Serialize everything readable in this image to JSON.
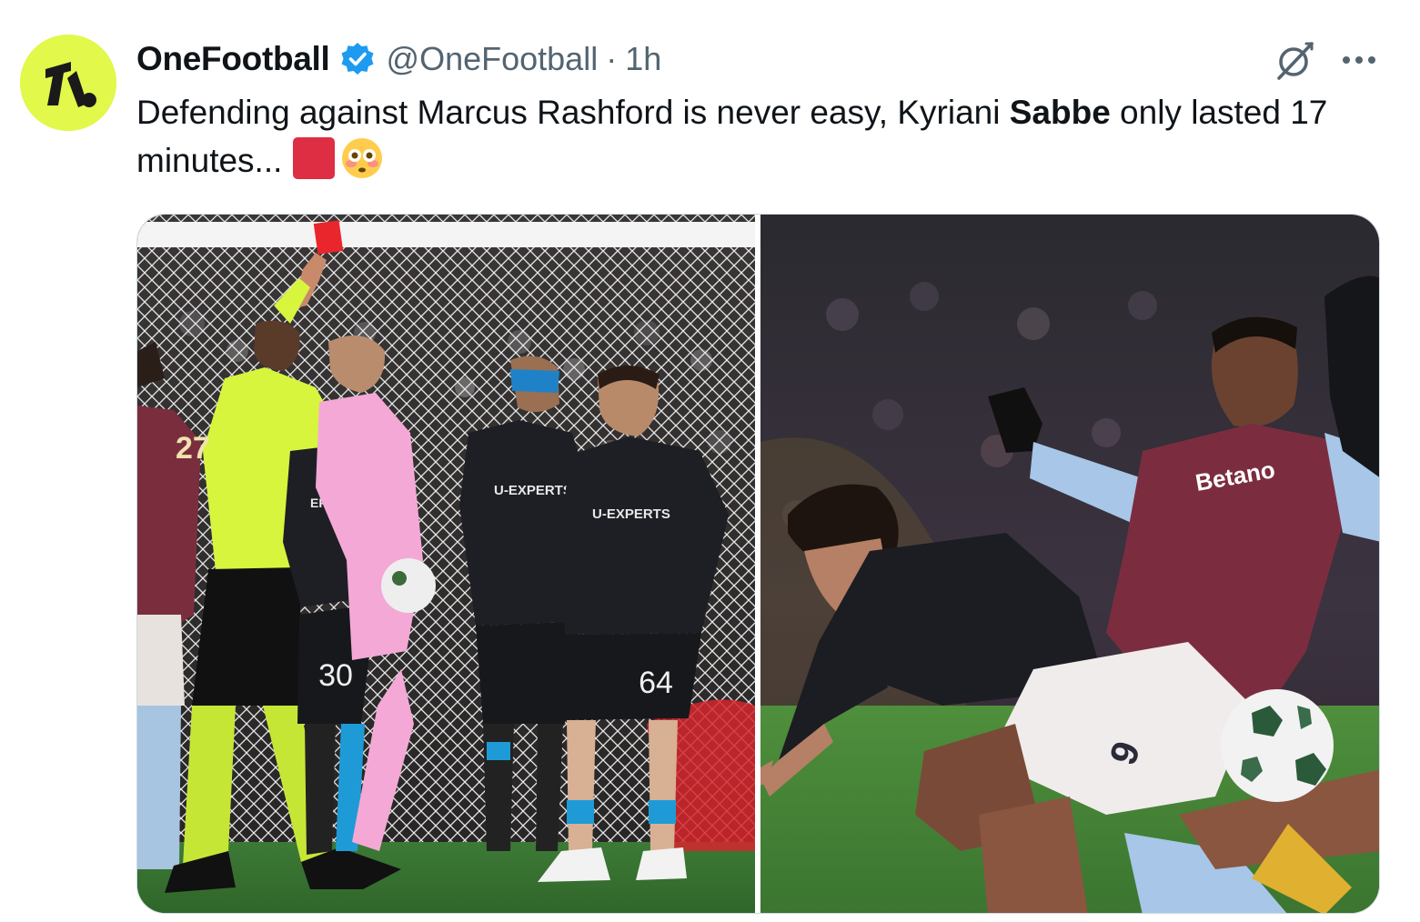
{
  "author": {
    "display_name": "OneFootball",
    "handle": "@OneFootball",
    "separator": "·",
    "time": "1h",
    "avatar_text": "1.",
    "verified": true,
    "avatar_color": "#e2f84a",
    "verified_color": "#1d9bf0"
  },
  "tweet": {
    "text_part1": "Defending against Marcus Rashford is never easy, Kyriani ",
    "text_bold": "Sabbe",
    "text_part2": " only lasted 17 minutes...",
    "emojis": [
      "red-square",
      "flushed-face"
    ]
  },
  "icons": {
    "grok": "grok-icon",
    "more": "more-icon"
  },
  "media": {
    "photo_left": {
      "shirt_text_1": "U-EXPERTS",
      "shirt_text_2": "U-EXPERTS",
      "shirt_text_3": "ERTS",
      "number_keeper": "30",
      "number_player": "64",
      "number_villa": "27"
    },
    "photo_right": {
      "shirt_sponsor": "Betano",
      "shorts_number": "9"
    }
  }
}
